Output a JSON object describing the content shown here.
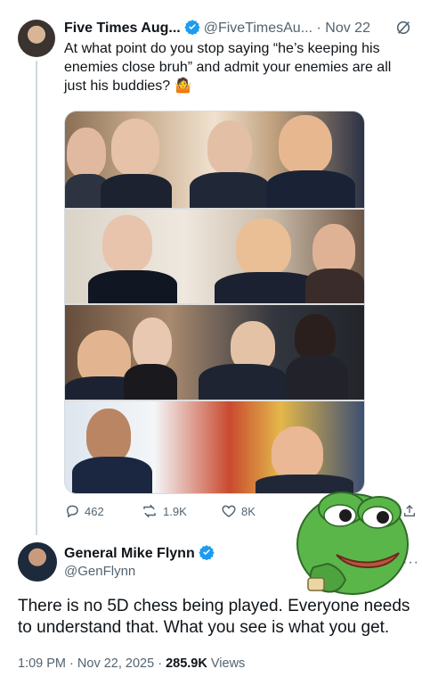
{
  "post": {
    "display_name": "Five Times Aug...",
    "handle": "@FiveTimesAu...",
    "separator": "·",
    "date": "Nov 22",
    "text": "At what point do you stop saying “he’s keeping his enemies close bruh” and admit your enemies are all just his buddies? 🤷",
    "media_panels": [
      "photo-panel-1",
      "photo-panel-2",
      "photo-panel-3",
      "photo-panel-4"
    ],
    "stats": {
      "replies": "462",
      "reposts": "1.9K",
      "likes": "8K"
    }
  },
  "reply": {
    "display_name": "General Mike Flynn",
    "handle": "@GenFlynn",
    "more": "···",
    "text": "There is no 5D chess being played. Everyone needs to understand that. What you see is what you get.",
    "time": "1:09 PM",
    "sep1": "·",
    "date": "Nov 22, 2025",
    "sep2": "·",
    "views_count": "285.9K",
    "views_label": "Views"
  },
  "colors": {
    "verified_blue": "#1d9bf0",
    "text_primary": "#0f1419",
    "text_muted": "#536471",
    "pepe_green": "#5bb64a"
  },
  "icons": [
    "verified-badge-icon",
    "grok-icon",
    "reply-icon",
    "repost-icon",
    "like-icon",
    "share-icon",
    "more-icon",
    "pepe-meme-sticker"
  ]
}
